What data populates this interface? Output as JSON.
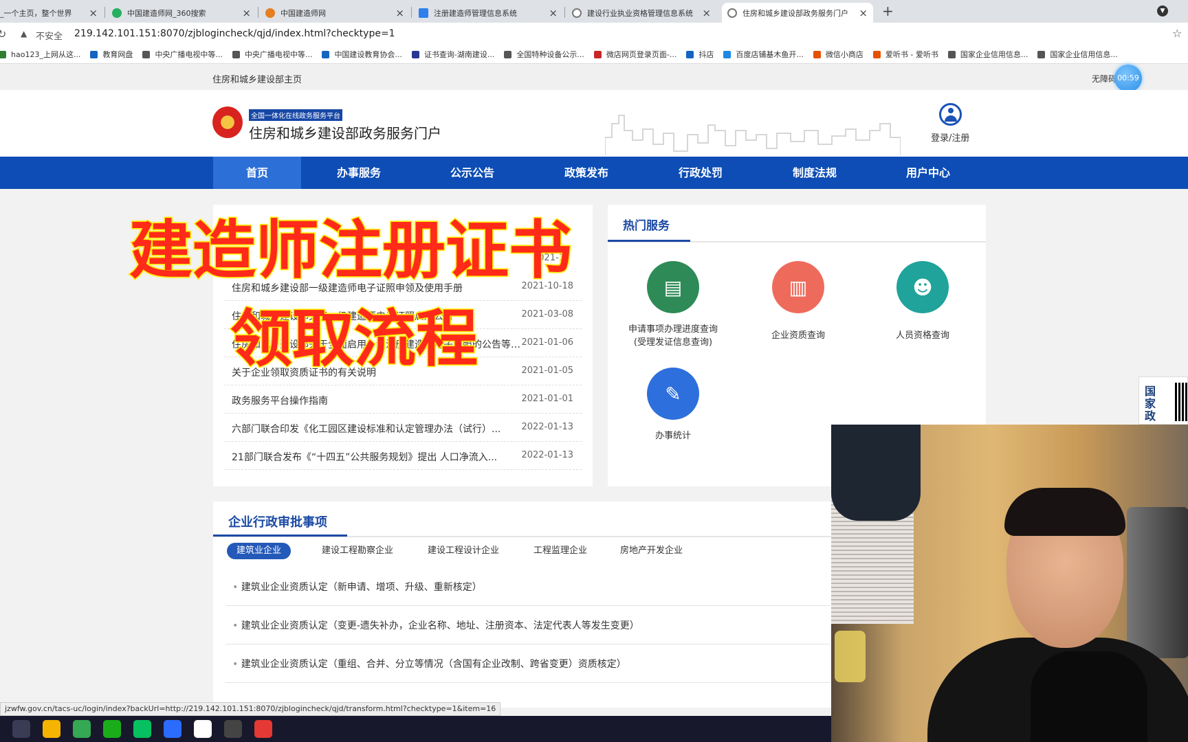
{
  "browser": {
    "tabs": [
      {
        "title": "_一个主页，整个世界",
        "color": "#2f80ed"
      },
      {
        "title": "中国建造师网_360搜索",
        "color": "#27ae60"
      },
      {
        "title": "中国建造师网",
        "color": "#e67e22"
      },
      {
        "title": "注册建造师管理信息系统",
        "color": "#2f80ed"
      },
      {
        "title": "建设行业执业资格管理信息系统",
        "color": "#777777"
      },
      {
        "title": "住房和城乡建设部政务服务门户",
        "color": "#777777"
      }
    ],
    "insecure": "不安全",
    "url": "219.142.101.151:8070/zjblogincheck/qjd/index.html?checktype=1",
    "bookmarks": [
      {
        "label": "hao123_上网从这...",
        "color": "#2e7d32"
      },
      {
        "label": "教育网盘",
        "color": "#1565c0"
      },
      {
        "label": "中央广播电视中等...",
        "color": "#555555"
      },
      {
        "label": "中央广播电视中等...",
        "color": "#555555"
      },
      {
        "label": "中国建设教育协会...",
        "color": "#1565c0"
      },
      {
        "label": "证书查询-湖南建设...",
        "color": "#283593"
      },
      {
        "label": "全国特种设备公示...",
        "color": "#555555"
      },
      {
        "label": "微店网页登录页面-...",
        "color": "#c62828"
      },
      {
        "label": "抖店",
        "color": "#1565c0"
      },
      {
        "label": "百度店铺基木鱼开...",
        "color": "#1e88e5"
      },
      {
        "label": "微信小商店",
        "color": "#e65100"
      },
      {
        "label": "爱听书 - 爱听书",
        "color": "#e65100"
      },
      {
        "label": "国家企业信用信息...",
        "color": "#555555"
      },
      {
        "label": "国家企业信用信息...",
        "color": "#555555"
      }
    ]
  },
  "site": {
    "home_link": "住房和城乡建设部主页",
    "accessibility": "无障碍",
    "timer": "00:59",
    "badge": "全国一体化在线政务服务平台",
    "portal_title": "住房和城乡建设部政务服务门户",
    "login": "登录/注册",
    "nav": [
      "首页",
      "办事服务",
      "公示公告",
      "政策发布",
      "行政处罚",
      "制度法规",
      "用户中心"
    ]
  },
  "notices": [
    {
      "title": "住房和城乡建设部一级建造师电子证照申领及使用手册",
      "date": "2021-10-18"
    },
    {
      "title": "住房和城乡建设部关于一级建造师电子证照启用公告",
      "date": "2021-03-08"
    },
    {
      "title": "住房和城乡建设部关于全面启用一级注册建造师电子证照的公告等级...",
      "date": "2021-01-06"
    },
    {
      "title": "关于企业领取资质证书的有关说明",
      "date": "2021-01-05"
    },
    {
      "title": "政务服务平台操作指南",
      "date": "2021-01-01"
    },
    {
      "title": "六部门联合印发《化工园区建设标准和认定管理办法（试行）...",
      "date": "2022-01-13"
    },
    {
      "title": "21部门联合发布《“十四五”公共服务规划》提出 人口净流入...",
      "date": "2022-01-13"
    }
  ],
  "notice_partial_date": "2021-1",
  "hot": {
    "title": "热门服务",
    "items": [
      {
        "line1": "申请事项办理进度查询",
        "line2": "(受理发证信息查询)",
        "color": "#2e8b57"
      },
      {
        "line1": "企业资质查询",
        "line2": "",
        "color": "#ee6b5c"
      },
      {
        "line1": "人员资格查询",
        "line2": "",
        "color": "#1fa39a"
      },
      {
        "line1": "办事统计",
        "line2": "",
        "color": "#2d6fdc"
      }
    ]
  },
  "approval": {
    "title": "企业行政审批事项",
    "tabs": [
      "建筑业企业",
      "建设工程勘察企业",
      "建设工程设计企业",
      "工程监理企业",
      "房地产开发企业"
    ],
    "rows": [
      "建筑业企业资质认定（新申请、增项、升级、重新核定）",
      "建筑业企业资质认定（变更-遗失补办，企业名称、地址、注册资本、法定代表人等发生变更）",
      "建筑业企业资质认定（重组、合并、分立等情况（含国有企业改制、跨省变更）资质核定）"
    ]
  },
  "side_qr": "国家政",
  "overlay": {
    "line1": "建造师注册证书",
    "line2": "领取流程"
  },
  "status_url": "jzwfw.gov.cn/tacs-uc/login/index?backUrl=http://219.142.101.151:8070/zjblogincheck/qjd/transform.html?checktype=1&item=16",
  "taskbar_colors": [
    "#3a3b55",
    "#f5b400",
    "#34a853",
    "#1aad19",
    "#07c160",
    "#2b6cff",
    "#ffffff",
    "#444444",
    "#e53935"
  ]
}
